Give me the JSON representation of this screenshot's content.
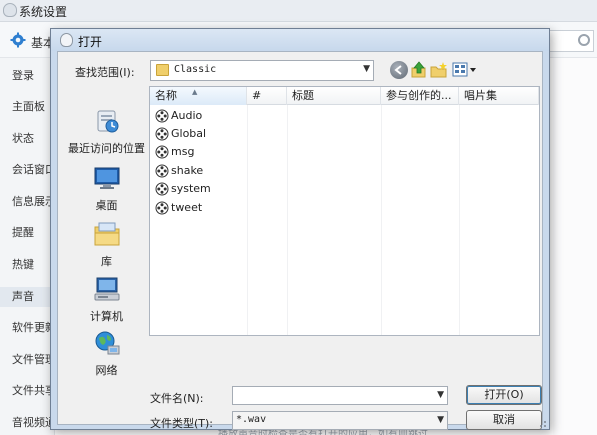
{
  "background_window": {
    "title": "系统设置",
    "tab_label": "基本",
    "sidebar_items": [
      "登录",
      "主面板",
      "状态",
      "会话窗口",
      "信息展示",
      "提醒",
      "热键",
      "声音",
      "软件更新",
      "文件管理",
      "文件共享",
      "音视频通话"
    ],
    "active_sidebar_index": 7,
    "bottom_text": "播放声音时检查是否有打开的应用，如有则跳过"
  },
  "dialog": {
    "title": "打开",
    "look_in_label": "查找范围(I):",
    "look_in_value": "Classic",
    "toolbar_icons": [
      "back-icon",
      "up-folder-icon",
      "new-folder-icon",
      "view-menu-icon"
    ],
    "places": [
      {
        "label": "最近访问的位置",
        "icon": "recent-places-icon"
      },
      {
        "label": "桌面",
        "icon": "desktop-icon"
      },
      {
        "label": "库",
        "icon": "libraries-icon"
      },
      {
        "label": "计算机",
        "icon": "computer-icon"
      },
      {
        "label": "网络",
        "icon": "network-icon"
      }
    ],
    "columns": [
      "名称",
      "#",
      "标题",
      "参与创作的...",
      "唱片集"
    ],
    "files": [
      "Audio",
      "Global",
      "msg",
      "shake",
      "system",
      "tweet"
    ],
    "file_name_label": "文件名(N):",
    "file_name_value": "",
    "file_type_label": "文件类型(T):",
    "file_type_value": "*.wav",
    "open_button": "打开(O)",
    "cancel_button": "取消"
  }
}
